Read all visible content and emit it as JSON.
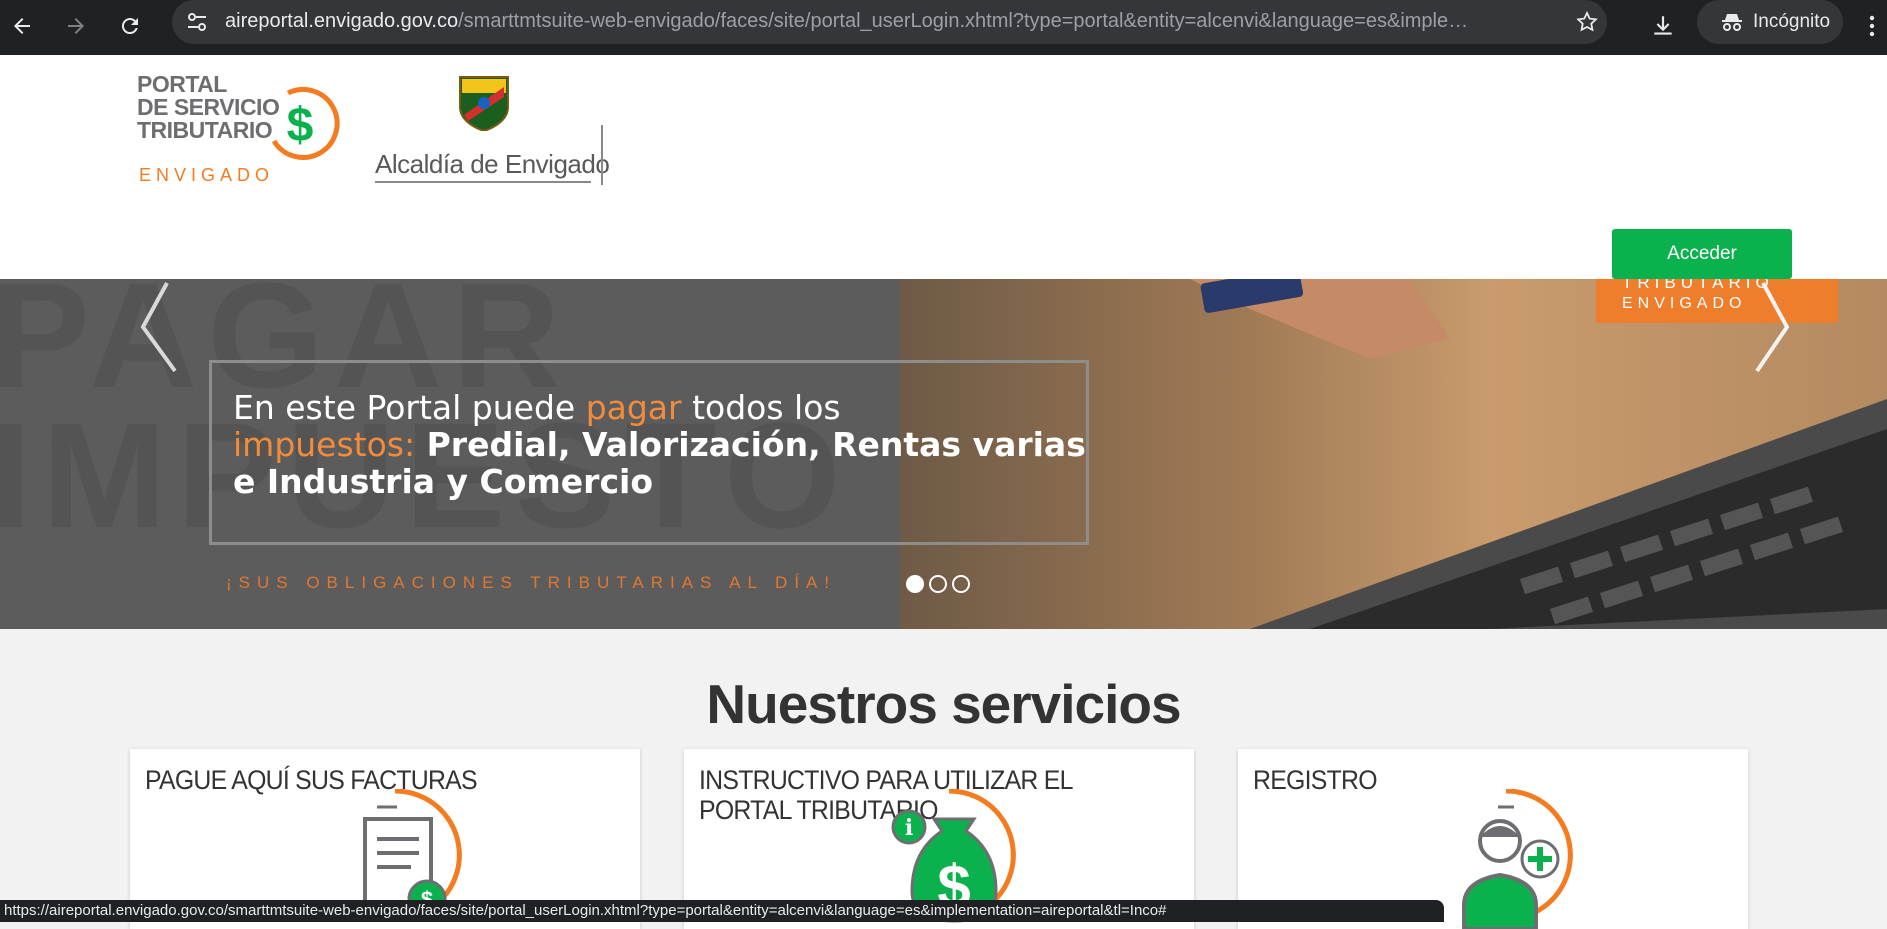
{
  "browser": {
    "url_host": "aireportal.envigado.gov.co",
    "url_path": "/smarttmtsuite-web-envigado/faces/site/portal_userLogin.xhtml?type=portal&entity=alcenvi&language=es&imple…",
    "incognito_label": "Incógnito",
    "status_url": "https://aireportal.envigado.gov.co/smarttmtsuite-web-envigado/faces/site/portal_userLogin.xhtml?type=portal&entity=alcenvi&language=es&implementation=aireportal&tl=Inco#"
  },
  "header": {
    "logo_portal_lines": [
      "PORTAL",
      "DE SERVICIO",
      "TRIBUTARIO"
    ],
    "logo_portal_city": "ENVIGADO",
    "logo_alcaldia": "Alcaldía de Envigado",
    "login_button": "Acceder"
  },
  "banner": {
    "bg_word_1": "PAGAR",
    "bg_word_2": "IMPUESTO",
    "headline_1": "En este Portal puede ",
    "headline_orange_1": "pagar",
    "headline_2": " todos los",
    "headline_orange_2": "impuestos:",
    "headline_bold": " Predial, Valorización, Rentas varias e Industria y Comercio",
    "tagline": "¡SUS OBLIGACIONES TRIBUTARIAS AL DÍA!",
    "badge_top": "TRIBUTARIO",
    "badge_bottom": "ENVIGADO",
    "slides": 3,
    "active_slide": 1
  },
  "services": {
    "title": "Nuestros servicios",
    "cards": [
      {
        "title": "PAGUE AQUÍ SUS FACTURAS",
        "icon": "invoice-icon"
      },
      {
        "title": "INSTRUCTIVO PARA UTILIZAR EL PORTAL TRIBUTARIO",
        "icon": "money-info-icon"
      },
      {
        "title": "REGISTRO",
        "icon": "user-add-icon"
      }
    ]
  },
  "colors": {
    "orange": "#f47b20",
    "green": "#0bb14d",
    "gray_text": "#6d6e71"
  }
}
